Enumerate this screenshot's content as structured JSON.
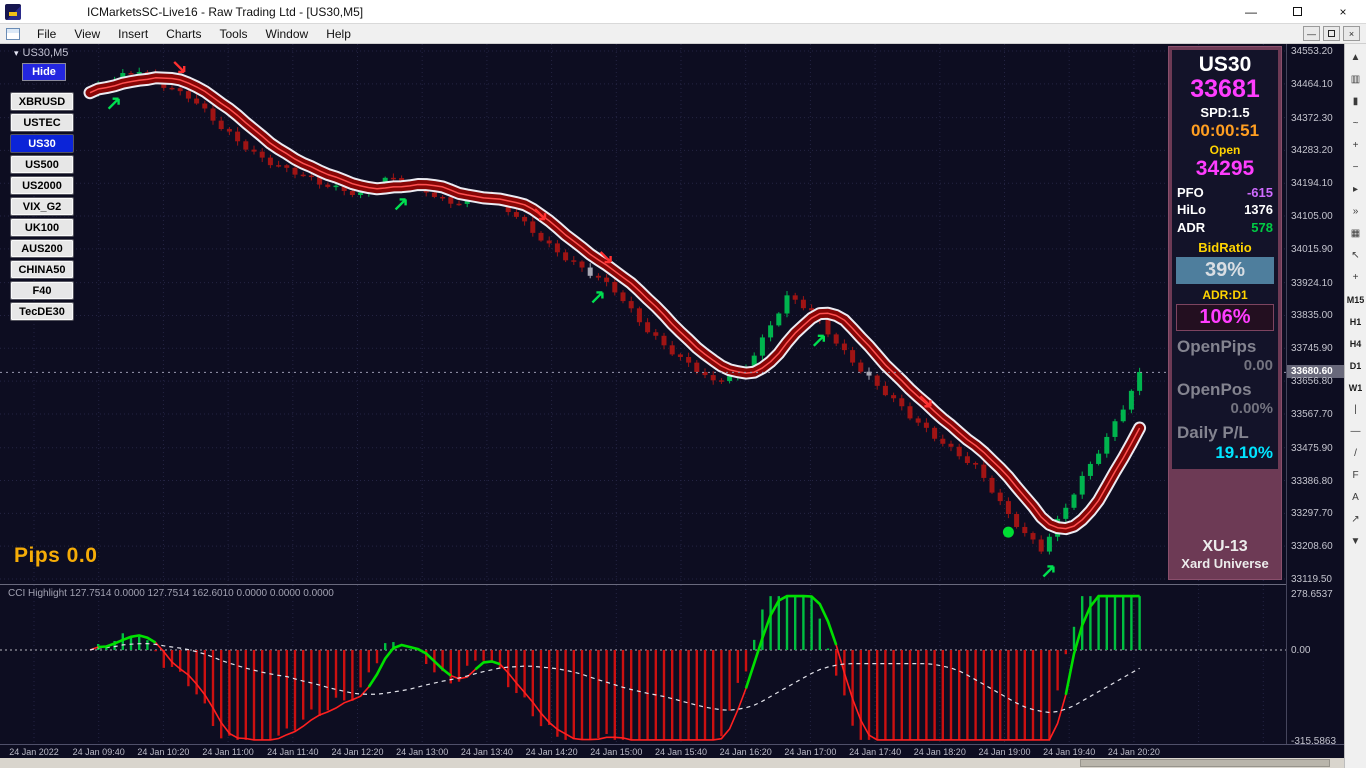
{
  "window": {
    "title": "ICMarketsSC-Live16 - Raw Trading Ltd - [US30,M5]",
    "controls": {
      "minimize": "—",
      "close": "×"
    }
  },
  "menu": {
    "items": [
      "File",
      "View",
      "Insert",
      "Charts",
      "Tools",
      "Window",
      "Help"
    ],
    "mdi": {
      "minimize": "—",
      "close": "×"
    }
  },
  "chart_tab": {
    "label": "US30,M5",
    "chevron": "▾"
  },
  "hide_button": "Hide",
  "symbols": [
    {
      "label": "XBRUSD",
      "active": false
    },
    {
      "label": "USTEC",
      "active": false
    },
    {
      "label": "US30",
      "active": true
    },
    {
      "label": "US500",
      "active": false
    },
    {
      "label": "US2000",
      "active": false
    },
    {
      "label": "VIX_G2",
      "active": false
    },
    {
      "label": "UK100",
      "active": false
    },
    {
      "label": "AUS200",
      "active": false
    },
    {
      "label": "CHINA50",
      "active": false
    },
    {
      "label": "F40",
      "active": false
    },
    {
      "label": "TecDE30",
      "active": false
    }
  ],
  "pips_label": "Pips 0.0",
  "info_panel": {
    "symbol": "US30",
    "price": "33681",
    "spread": "SPD:1.5",
    "timer": "00:00:51",
    "open_label": "Open",
    "open_price": "34295",
    "rows": [
      {
        "label": "PFO",
        "value": "-615",
        "color": "#cf6bff"
      },
      {
        "label": "HiLo",
        "value": "1376",
        "color": "#ffffff"
      },
      {
        "label": "ADR",
        "value": "578",
        "color": "#00cc44"
      }
    ],
    "bid_ratio_label": "BidRatio",
    "bid_ratio": "39%",
    "adr_label": "ADR:D1",
    "adr_value": "106%",
    "open_pips_label": "OpenPips",
    "open_pips": "0.00",
    "open_pos_label": "OpenPos",
    "open_pos": "0.00%",
    "daily_pl_label": "Daily P/L",
    "daily_pl": "19.10%",
    "footer1": "XU-13",
    "footer2": "Xard Universe"
  },
  "price_axis": {
    "labels": [
      "34553.20",
      "34464.10",
      "34372.30",
      "34283.20",
      "34194.10",
      "34105.00",
      "34015.90",
      "33924.10",
      "33835.00",
      "33745.90",
      "33656.80",
      "33567.70",
      "33475.90",
      "33386.80",
      "33297.70",
      "33208.60",
      "33119.50"
    ],
    "current_price": "33680.60"
  },
  "time_axis": [
    "24 Jan 2022",
    "24 Jan 09:40",
    "24 Jan 10:20",
    "24 Jan 11:00",
    "24 Jan 11:40",
    "24 Jan 12:20",
    "24 Jan 13:00",
    "24 Jan 13:40",
    "24 Jan 14:20",
    "24 Jan 15:00",
    "24 Jan 15:40",
    "24 Jan 16:20",
    "24 Jan 17:00",
    "24 Jan 17:40",
    "24 Jan 18:20",
    "24 Jan 19:00",
    "24 Jan 19:40",
    "24 Jan 20:20"
  ],
  "toolbar": {
    "items": [
      {
        "name": "scroll-up",
        "glyph": "▲"
      },
      {
        "name": "bar-chart",
        "glyph": "▥"
      },
      {
        "name": "candlestick",
        "glyph": "▮"
      },
      {
        "name": "line-chart",
        "glyph": "~"
      },
      {
        "name": "zoom-in",
        "glyph": "+"
      },
      {
        "name": "zoom-out",
        "glyph": "−"
      },
      {
        "name": "auto-scroll",
        "glyph": "▸"
      },
      {
        "name": "chart-shift",
        "glyph": "»"
      },
      {
        "name": "grid",
        "glyph": "▦"
      },
      {
        "name": "cursor",
        "glyph": "↖"
      },
      {
        "name": "crosshair",
        "glyph": "+"
      },
      {
        "name": "period-m15",
        "glyph": "M15",
        "tf": true
      },
      {
        "name": "period-h1",
        "glyph": "H1",
        "tf": true
      },
      {
        "name": "period-h4",
        "glyph": "H4",
        "tf": true
      },
      {
        "name": "period-d1",
        "glyph": "D1",
        "tf": true
      },
      {
        "name": "period-w1",
        "glyph": "W1",
        "tf": true
      },
      {
        "name": "vertical-line",
        "glyph": "|"
      },
      {
        "name": "horizontal-line",
        "glyph": "—"
      },
      {
        "name": "trendline",
        "glyph": "/"
      },
      {
        "name": "fibonacci",
        "glyph": "F"
      },
      {
        "name": "text-label",
        "glyph": "A"
      },
      {
        "name": "arrow-objects",
        "glyph": "↗"
      },
      {
        "name": "scroll-down",
        "glyph": "▼"
      }
    ]
  },
  "chart_data": {
    "type": "candlestick",
    "symbol": "US30",
    "timeframe": "M5",
    "price_max": 34553.2,
    "price_min": 33119.5,
    "current_price": 33680.6,
    "bars": 129,
    "close_anchors": [
      [
        0,
        34440
      ],
      [
        6,
        34502
      ],
      [
        12,
        34430
      ],
      [
        16,
        34340
      ],
      [
        20,
        34280
      ],
      [
        24,
        34230
      ],
      [
        28,
        34190
      ],
      [
        33,
        34170
      ],
      [
        36,
        34205
      ],
      [
        40,
        34180
      ],
      [
        44,
        34145
      ],
      [
        48,
        34165
      ],
      [
        52,
        34100
      ],
      [
        56,
        34030
      ],
      [
        60,
        33960
      ],
      [
        64,
        33900
      ],
      [
        68,
        33800
      ],
      [
        72,
        33715
      ],
      [
        76,
        33650
      ],
      [
        80,
        33700
      ],
      [
        85,
        33880
      ],
      [
        88,
        33845
      ],
      [
        92,
        33740
      ],
      [
        96,
        33640
      ],
      [
        100,
        33560
      ],
      [
        104,
        33495
      ],
      [
        108,
        33420
      ],
      [
        112,
        33290
      ],
      [
        116,
        33205
      ],
      [
        120,
        33350
      ],
      [
        124,
        33500
      ],
      [
        128,
        33681
      ]
    ],
    "signals": {
      "up_arrow_bars": [
        3,
        38,
        62,
        89,
        117
      ],
      "down_arrow_bars": [
        11,
        55,
        63,
        102
      ],
      "dot_bar": 112,
      "gray_bars": [
        40,
        61,
        95
      ]
    },
    "indicator": {
      "name": "CCI Highlight",
      "header": "CCI Highlight 127.7514 0.0000 127.7514 162.6010 0.0000 0.0000 0.0000",
      "scale_labels": [
        "278.6537",
        "0.00",
        "-315.5863"
      ],
      "scale_max": 278.6537,
      "scale_min": -315.5863
    }
  }
}
